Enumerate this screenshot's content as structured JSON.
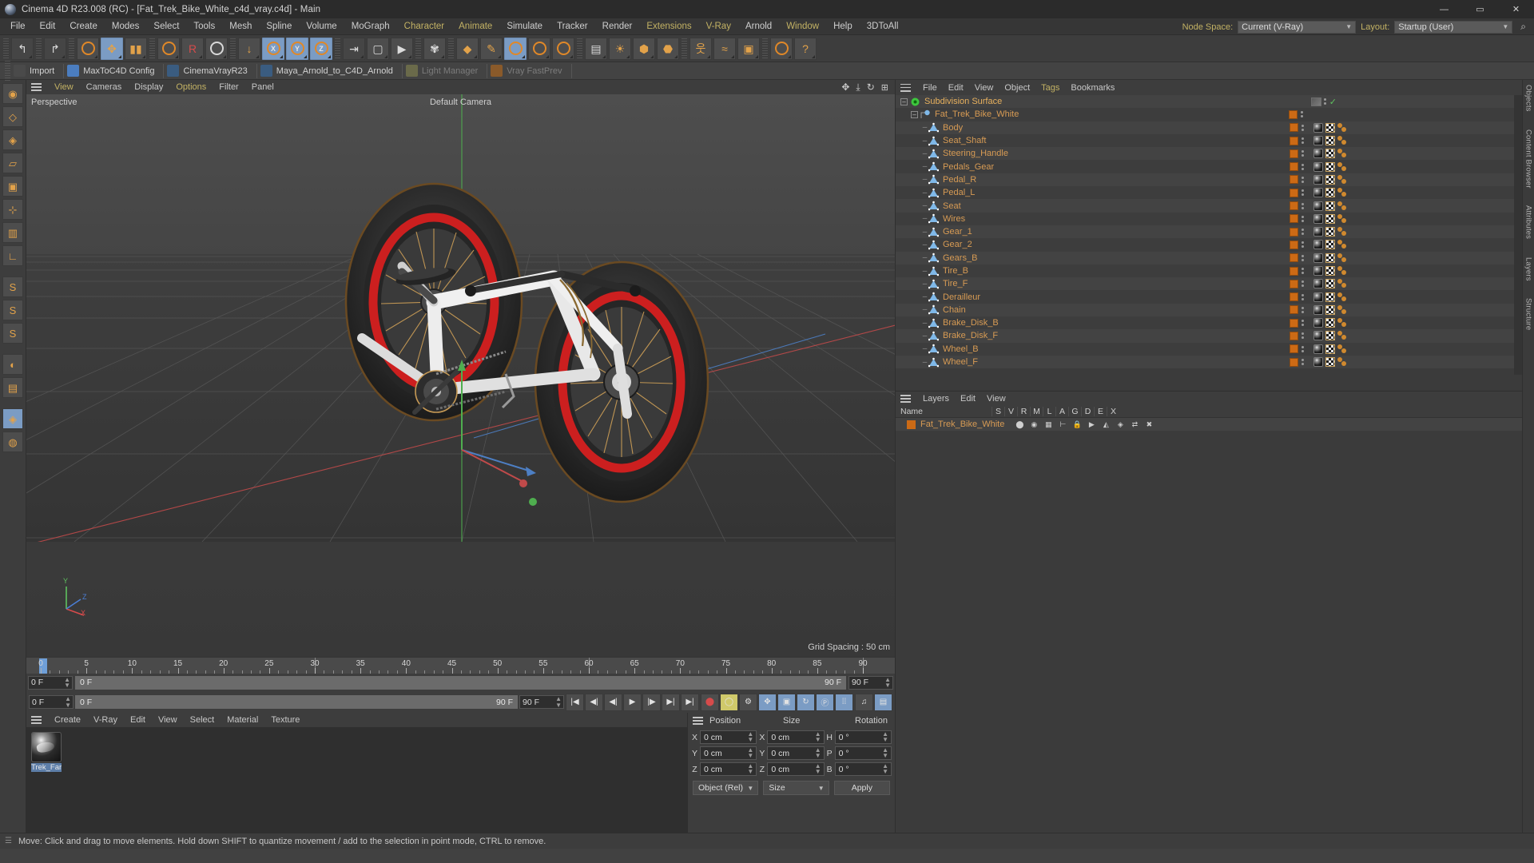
{
  "titlebar": {
    "app_title": "Cinema 4D R23.008 (RC) - [Fat_Trek_Bike_White_c4d_vray.c4d] - Main",
    "minimize": "—",
    "maximize": "▭",
    "close": "✕"
  },
  "menubar": {
    "items": [
      {
        "label": "File",
        "highlight": false
      },
      {
        "label": "Edit",
        "highlight": false
      },
      {
        "label": "Create",
        "highlight": false
      },
      {
        "label": "Modes",
        "highlight": false
      },
      {
        "label": "Select",
        "highlight": false
      },
      {
        "label": "Tools",
        "highlight": false
      },
      {
        "label": "Mesh",
        "highlight": false
      },
      {
        "label": "Spline",
        "highlight": false
      },
      {
        "label": "Volume",
        "highlight": false
      },
      {
        "label": "MoGraph",
        "highlight": false
      },
      {
        "label": "Character",
        "highlight": true
      },
      {
        "label": "Animate",
        "highlight": true
      },
      {
        "label": "Simulate",
        "highlight": false
      },
      {
        "label": "Tracker",
        "highlight": false
      },
      {
        "label": "Render",
        "highlight": false
      },
      {
        "label": "Extensions",
        "highlight": true
      },
      {
        "label": "V-Ray",
        "highlight": true
      },
      {
        "label": "Arnold",
        "highlight": false
      },
      {
        "label": "Window",
        "highlight": true
      },
      {
        "label": "Help",
        "highlight": false
      },
      {
        "label": "3DToAll",
        "highlight": false
      }
    ],
    "node_space_label": "Node Space:",
    "node_space_value": "Current (V-Ray)",
    "layout_label": "Layout:",
    "layout_value": "Startup (User)",
    "search_icon": "search-icon"
  },
  "toolbar": {
    "buttons": [
      {
        "name": "undo-icon",
        "glyph": "↰",
        "state": "flat"
      },
      {
        "name": "redo-icon",
        "glyph": "↱",
        "state": "flat"
      },
      {
        "name": "live-selection-icon",
        "glyph": "◉",
        "state": "normal"
      },
      {
        "name": "move-tool-icon",
        "glyph": "✥",
        "state": "active"
      },
      {
        "name": "scale-tool-icon",
        "glyph": "▮▮",
        "state": "normal"
      },
      {
        "name": "rotate-tool-icon",
        "glyph": "↻",
        "state": "normal"
      },
      {
        "name": "record-icon",
        "glyph": "R",
        "state": "normal"
      },
      {
        "name": "reset-psr-icon",
        "glyph": "○",
        "state": "normal"
      },
      {
        "name": "axis-move-icon",
        "glyph": "↓",
        "state": "normal"
      },
      {
        "name": "x-axis-lock-icon",
        "glyph": "X",
        "state": "active"
      },
      {
        "name": "y-axis-lock-icon",
        "glyph": "Y",
        "state": "active"
      },
      {
        "name": "z-axis-lock-icon",
        "glyph": "Z",
        "state": "active"
      },
      {
        "name": "world-object-coord-icon",
        "glyph": "⇥",
        "state": "flat"
      },
      {
        "name": "render-view-icon",
        "glyph": "▢",
        "state": "normal"
      },
      {
        "name": "render-picture-viewer-icon",
        "glyph": "▶",
        "state": "normal"
      },
      {
        "name": "render-settings-icon",
        "glyph": "✾",
        "state": "normal"
      },
      {
        "name": "primitive-cube-icon",
        "glyph": "◆",
        "state": "normal"
      },
      {
        "name": "spline-pen-icon",
        "glyph": "✎",
        "state": "normal"
      },
      {
        "name": "generator-icon",
        "glyph": "◍",
        "state": "active"
      },
      {
        "name": "deformer-icon",
        "glyph": "◐",
        "state": "normal"
      },
      {
        "name": "environment-icon",
        "glyph": "◓",
        "state": "normal"
      },
      {
        "name": "camera-icon",
        "glyph": "▤",
        "state": "normal"
      },
      {
        "name": "light-icon",
        "glyph": "☀",
        "state": "normal"
      },
      {
        "name": "mograph-icon",
        "glyph": "⬢",
        "state": "normal"
      },
      {
        "name": "field-icon",
        "glyph": "⬣",
        "state": "normal"
      },
      {
        "name": "character-icon",
        "glyph": "웃",
        "state": "normal"
      },
      {
        "name": "simulate-icon",
        "glyph": "≈",
        "state": "normal"
      },
      {
        "name": "volume-icon",
        "glyph": "▣",
        "state": "normal"
      },
      {
        "name": "motion-tracker-icon",
        "glyph": "◎",
        "state": "normal"
      },
      {
        "name": "help-icon",
        "glyph": "?",
        "state": "normal"
      }
    ]
  },
  "pluginbar": {
    "items": [
      {
        "label": "Import",
        "icon": "import-icon",
        "icon_color": "#4a4a4a",
        "dim": false
      },
      {
        "label": "MaxToC4D Config",
        "icon": "wrench-icon",
        "icon_color": "#4b7dbf",
        "dim": false
      },
      {
        "label": "CinemaVrayR23",
        "icon": "python-icon",
        "icon_color": "#3a5c80",
        "dim": false
      },
      {
        "label": "Maya_Arnold_to_C4D_Arnold",
        "icon": "python-icon",
        "icon_color": "#3a5c80",
        "dim": false
      },
      {
        "label": "Light Manager",
        "icon": "shield-icon",
        "icon_color": "#6a6a4a",
        "dim": true
      },
      {
        "label": "Vray FastPrev",
        "icon": "play-icon",
        "icon_color": "#8a5a2a",
        "dim": true
      }
    ]
  },
  "leftbar": {
    "buttons": [
      {
        "name": "live-selection-mode-icon",
        "glyph": "◉",
        "state": "normal"
      },
      {
        "name": "point-mode-icon",
        "glyph": "◇",
        "state": "normal"
      },
      {
        "name": "edge-mode-icon",
        "glyph": "◈",
        "state": "normal"
      },
      {
        "name": "polygon-mode-icon",
        "glyph": "▱",
        "state": "normal"
      },
      {
        "name": "model-mode-icon",
        "glyph": "▣",
        "state": "normal"
      },
      {
        "name": "object-axis-mode-icon",
        "glyph": "⊹",
        "state": "normal"
      },
      {
        "name": "texture-mode-icon",
        "glyph": "▥",
        "state": "normal"
      },
      {
        "name": "workplane-mode-icon",
        "glyph": "∟",
        "state": "normal"
      },
      {
        "name": "enable-axis-icon",
        "glyph": "S",
        "state": "normal"
      },
      {
        "name": "enable-snap-icon",
        "glyph": "S",
        "state": "normal"
      },
      {
        "name": "quantize-icon",
        "glyph": "S",
        "state": "normal"
      },
      {
        "name": "viewport-solo-icon",
        "glyph": "◐",
        "state": "normal"
      },
      {
        "name": "layers-toggle-icon",
        "glyph": "▤",
        "state": "normal"
      },
      {
        "name": "gouraud-shading-icon",
        "glyph": "◈",
        "state": "active"
      },
      {
        "name": "isoline-icon",
        "glyph": "◍",
        "state": "normal"
      }
    ]
  },
  "viewport": {
    "menus": [
      {
        "label": "View",
        "highlight": true
      },
      {
        "label": "Cameras",
        "highlight": false
      },
      {
        "label": "Display",
        "highlight": false
      },
      {
        "label": "Options",
        "highlight": true
      },
      {
        "label": "Filter",
        "highlight": false
      },
      {
        "label": "Panel",
        "highlight": false
      }
    ],
    "corner_icons": [
      "pan-icon",
      "dolly-icon",
      "rotate-icon",
      "maximize-icon"
    ],
    "label_top_left": "Perspective",
    "label_top_center": "Default Camera",
    "label_bottom_right": "Grid Spacing : 50 cm",
    "axis_labels": {
      "x": "X",
      "y": "Y",
      "z": "Z"
    },
    "axis_colors": {
      "x": "#d64b4b",
      "y": "#5fc25f",
      "z": "#4b7fd6"
    }
  },
  "timeline": {
    "ticks": [
      0,
      5,
      10,
      15,
      20,
      25,
      30,
      35,
      40,
      45,
      50,
      55,
      60,
      65,
      70,
      75,
      80,
      85,
      90
    ],
    "start_frame_field": "0 F",
    "current_frame_left": "0 F",
    "current_frame_right": "90 F",
    "end_frame_field": "90 F",
    "preview_min": "0 F",
    "preview_max": "90 F",
    "playhead_frame": 0,
    "transport": [
      {
        "name": "go-to-start-button",
        "glyph": "|◀"
      },
      {
        "name": "previous-key-button",
        "glyph": "◀|"
      },
      {
        "name": "previous-frame-button",
        "glyph": "◀|"
      },
      {
        "name": "play-button",
        "glyph": "▶"
      },
      {
        "name": "next-frame-button",
        "glyph": "|▶"
      },
      {
        "name": "next-key-button",
        "glyph": "▶|"
      },
      {
        "name": "go-to-end-button",
        "glyph": "▶|"
      }
    ],
    "record_buttons": [
      {
        "name": "record-active-objects-button",
        "glyph": "⬤",
        "state": "red"
      },
      {
        "name": "autokeying-button",
        "glyph": "◯",
        "state": "yellowsel"
      },
      {
        "name": "keyframe-selection-button",
        "glyph": "⚙",
        "state": "normal"
      },
      {
        "name": "position-key-button",
        "glyph": "✥",
        "state": "blue"
      },
      {
        "name": "scale-key-button",
        "glyph": "▣",
        "state": "blue"
      },
      {
        "name": "rotation-key-button",
        "glyph": "↻",
        "state": "blue"
      },
      {
        "name": "parameter-key-button",
        "glyph": "Ⓟ",
        "state": "blue"
      },
      {
        "name": "point-level-anim-button",
        "glyph": "⁞⁞",
        "state": "blue"
      }
    ],
    "right_buttons": [
      {
        "name": "sound-icon",
        "glyph": "♫",
        "state": "normal"
      },
      {
        "name": "timeline-icon",
        "glyph": "▤",
        "state": "blue"
      }
    ]
  },
  "material_manager": {
    "menus": [
      "Create",
      "V-Ray",
      "Edit",
      "View",
      "Select",
      "Material",
      "Texture"
    ],
    "materials": [
      {
        "name": "Trek_Farl",
        "preview": "chrome-sphere"
      }
    ]
  },
  "coordinates": {
    "columns": [
      "Position",
      "Size",
      "Rotation"
    ],
    "rows": [
      {
        "pos_label": "X",
        "pos_value": "0 cm",
        "size_label": "X",
        "size_value": "0 cm",
        "rot_label": "H",
        "rot_value": "0 °"
      },
      {
        "pos_label": "Y",
        "pos_value": "0 cm",
        "size_label": "Y",
        "size_value": "0 cm",
        "rot_label": "P",
        "rot_value": "0 °"
      },
      {
        "pos_label": "Z",
        "pos_value": "0 cm",
        "size_label": "Z",
        "size_value": "0 cm",
        "rot_label": "B",
        "rot_value": "0 °"
      }
    ],
    "mode_select": "Object (Rel)",
    "size_select": "Size",
    "apply_button": "Apply"
  },
  "object_manager": {
    "menus": [
      "File",
      "Edit",
      "View",
      "Object",
      "Tags",
      "Bookmarks"
    ],
    "objects": [
      {
        "label": "Subdivision Surface",
        "depth": 0,
        "icon": "subdivision-surface-icon",
        "selected": true,
        "has_expand": true,
        "tags": "subdiv"
      },
      {
        "label": "Fat_Trek_Bike_White",
        "depth": 1,
        "icon": "null-object-icon",
        "selected": false,
        "has_expand": true,
        "tags": "layer"
      },
      {
        "label": "Body",
        "depth": 2,
        "icon": "polygon-object-icon",
        "selected": false,
        "has_expand": false,
        "tags": "full"
      },
      {
        "label": "Seat_Shaft",
        "depth": 2,
        "icon": "polygon-object-icon",
        "selected": false,
        "has_expand": false,
        "tags": "full"
      },
      {
        "label": "Steering_Handle",
        "depth": 2,
        "icon": "polygon-object-icon",
        "selected": false,
        "has_expand": false,
        "tags": "full"
      },
      {
        "label": "Pedals_Gear",
        "depth": 2,
        "icon": "polygon-object-icon",
        "selected": false,
        "has_expand": false,
        "tags": "full"
      },
      {
        "label": "Pedal_R",
        "depth": 2,
        "icon": "polygon-object-icon",
        "selected": false,
        "has_expand": false,
        "tags": "full"
      },
      {
        "label": "Pedal_L",
        "depth": 2,
        "icon": "polygon-object-icon",
        "selected": false,
        "has_expand": false,
        "tags": "full"
      },
      {
        "label": "Seat",
        "depth": 2,
        "icon": "polygon-object-icon",
        "selected": false,
        "has_expand": false,
        "tags": "full"
      },
      {
        "label": "Wires",
        "depth": 2,
        "icon": "polygon-object-icon",
        "selected": false,
        "has_expand": false,
        "tags": "full"
      },
      {
        "label": "Gear_1",
        "depth": 2,
        "icon": "polygon-object-icon",
        "selected": false,
        "has_expand": false,
        "tags": "full"
      },
      {
        "label": "Gear_2",
        "depth": 2,
        "icon": "polygon-object-icon",
        "selected": false,
        "has_expand": false,
        "tags": "full"
      },
      {
        "label": "Gears_B",
        "depth": 2,
        "icon": "polygon-object-icon",
        "selected": false,
        "has_expand": false,
        "tags": "full"
      },
      {
        "label": "Tire_B",
        "depth": 2,
        "icon": "polygon-object-icon",
        "selected": false,
        "has_expand": false,
        "tags": "full"
      },
      {
        "label": "Tire_F",
        "depth": 2,
        "icon": "polygon-object-icon",
        "selected": false,
        "has_expand": false,
        "tags": "full"
      },
      {
        "label": "Derailleur",
        "depth": 2,
        "icon": "polygon-object-icon",
        "selected": false,
        "has_expand": false,
        "tags": "full"
      },
      {
        "label": "Chain",
        "depth": 2,
        "icon": "polygon-object-icon",
        "selected": false,
        "has_expand": false,
        "tags": "full"
      },
      {
        "label": "Brake_Disk_B",
        "depth": 2,
        "icon": "polygon-object-icon",
        "selected": false,
        "has_expand": false,
        "tags": "full"
      },
      {
        "label": "Brake_Disk_F",
        "depth": 2,
        "icon": "polygon-object-icon",
        "selected": false,
        "has_expand": false,
        "tags": "full"
      },
      {
        "label": "Wheel_B",
        "depth": 2,
        "icon": "polygon-object-icon",
        "selected": false,
        "has_expand": false,
        "tags": "full"
      },
      {
        "label": "Wheel_F",
        "depth": 2,
        "icon": "polygon-object-icon",
        "selected": false,
        "has_expand": false,
        "tags": "full"
      }
    ]
  },
  "layers_panel": {
    "menus": [
      "Layers",
      "Edit",
      "View"
    ],
    "columns": [
      "Name",
      "S",
      "V",
      "R",
      "M",
      "L",
      "A",
      "G",
      "D",
      "E",
      "X"
    ],
    "rows": [
      {
        "name": "Fat_Trek_Bike_White",
        "color": "#cc6a15"
      }
    ]
  },
  "right_tabs": [
    "Objects",
    "Content Browser",
    "Attributes",
    "Layers",
    "Structure"
  ],
  "statusbar": {
    "message": "Move: Click and drag to move elements. Hold down SHIFT to quantize movement / add to the selection in point mode, CTRL to remove."
  }
}
